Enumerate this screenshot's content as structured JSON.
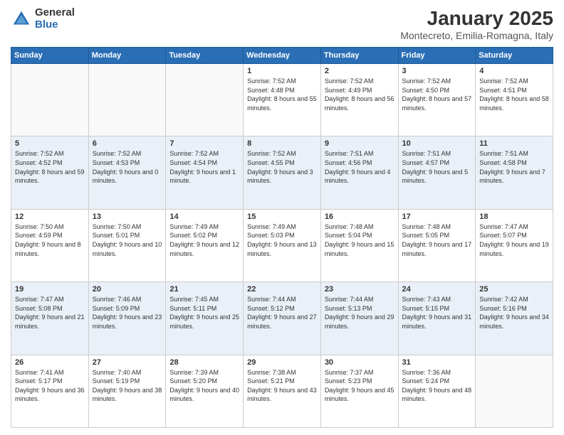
{
  "logo": {
    "general": "General",
    "blue": "Blue"
  },
  "header": {
    "title": "January 2025",
    "subtitle": "Montecreto, Emilia-Romagna, Italy"
  },
  "weekdays": [
    "Sunday",
    "Monday",
    "Tuesday",
    "Wednesday",
    "Thursday",
    "Friday",
    "Saturday"
  ],
  "weeks": [
    [
      {
        "day": "",
        "sunrise": "",
        "sunset": "",
        "daylight": ""
      },
      {
        "day": "",
        "sunrise": "",
        "sunset": "",
        "daylight": ""
      },
      {
        "day": "",
        "sunrise": "",
        "sunset": "",
        "daylight": ""
      },
      {
        "day": "1",
        "sunrise": "Sunrise: 7:52 AM",
        "sunset": "Sunset: 4:48 PM",
        "daylight": "Daylight: 8 hours and 55 minutes."
      },
      {
        "day": "2",
        "sunrise": "Sunrise: 7:52 AM",
        "sunset": "Sunset: 4:49 PM",
        "daylight": "Daylight: 8 hours and 56 minutes."
      },
      {
        "day": "3",
        "sunrise": "Sunrise: 7:52 AM",
        "sunset": "Sunset: 4:50 PM",
        "daylight": "Daylight: 8 hours and 57 minutes."
      },
      {
        "day": "4",
        "sunrise": "Sunrise: 7:52 AM",
        "sunset": "Sunset: 4:51 PM",
        "daylight": "Daylight: 8 hours and 58 minutes."
      }
    ],
    [
      {
        "day": "5",
        "sunrise": "Sunrise: 7:52 AM",
        "sunset": "Sunset: 4:52 PM",
        "daylight": "Daylight: 8 hours and 59 minutes."
      },
      {
        "day": "6",
        "sunrise": "Sunrise: 7:52 AM",
        "sunset": "Sunset: 4:53 PM",
        "daylight": "Daylight: 9 hours and 0 minutes."
      },
      {
        "day": "7",
        "sunrise": "Sunrise: 7:52 AM",
        "sunset": "Sunset: 4:54 PM",
        "daylight": "Daylight: 9 hours and 1 minute."
      },
      {
        "day": "8",
        "sunrise": "Sunrise: 7:52 AM",
        "sunset": "Sunset: 4:55 PM",
        "daylight": "Daylight: 9 hours and 3 minutes."
      },
      {
        "day": "9",
        "sunrise": "Sunrise: 7:51 AM",
        "sunset": "Sunset: 4:56 PM",
        "daylight": "Daylight: 9 hours and 4 minutes."
      },
      {
        "day": "10",
        "sunrise": "Sunrise: 7:51 AM",
        "sunset": "Sunset: 4:57 PM",
        "daylight": "Daylight: 9 hours and 5 minutes."
      },
      {
        "day": "11",
        "sunrise": "Sunrise: 7:51 AM",
        "sunset": "Sunset: 4:58 PM",
        "daylight": "Daylight: 9 hours and 7 minutes."
      }
    ],
    [
      {
        "day": "12",
        "sunrise": "Sunrise: 7:50 AM",
        "sunset": "Sunset: 4:59 PM",
        "daylight": "Daylight: 9 hours and 8 minutes."
      },
      {
        "day": "13",
        "sunrise": "Sunrise: 7:50 AM",
        "sunset": "Sunset: 5:01 PM",
        "daylight": "Daylight: 9 hours and 10 minutes."
      },
      {
        "day": "14",
        "sunrise": "Sunrise: 7:49 AM",
        "sunset": "Sunset: 5:02 PM",
        "daylight": "Daylight: 9 hours and 12 minutes."
      },
      {
        "day": "15",
        "sunrise": "Sunrise: 7:49 AM",
        "sunset": "Sunset: 5:03 PM",
        "daylight": "Daylight: 9 hours and 13 minutes."
      },
      {
        "day": "16",
        "sunrise": "Sunrise: 7:48 AM",
        "sunset": "Sunset: 5:04 PM",
        "daylight": "Daylight: 9 hours and 15 minutes."
      },
      {
        "day": "17",
        "sunrise": "Sunrise: 7:48 AM",
        "sunset": "Sunset: 5:05 PM",
        "daylight": "Daylight: 9 hours and 17 minutes."
      },
      {
        "day": "18",
        "sunrise": "Sunrise: 7:47 AM",
        "sunset": "Sunset: 5:07 PM",
        "daylight": "Daylight: 9 hours and 19 minutes."
      }
    ],
    [
      {
        "day": "19",
        "sunrise": "Sunrise: 7:47 AM",
        "sunset": "Sunset: 5:08 PM",
        "daylight": "Daylight: 9 hours and 21 minutes."
      },
      {
        "day": "20",
        "sunrise": "Sunrise: 7:46 AM",
        "sunset": "Sunset: 5:09 PM",
        "daylight": "Daylight: 9 hours and 23 minutes."
      },
      {
        "day": "21",
        "sunrise": "Sunrise: 7:45 AM",
        "sunset": "Sunset: 5:11 PM",
        "daylight": "Daylight: 9 hours and 25 minutes."
      },
      {
        "day": "22",
        "sunrise": "Sunrise: 7:44 AM",
        "sunset": "Sunset: 5:12 PM",
        "daylight": "Daylight: 9 hours and 27 minutes."
      },
      {
        "day": "23",
        "sunrise": "Sunrise: 7:44 AM",
        "sunset": "Sunset: 5:13 PM",
        "daylight": "Daylight: 9 hours and 29 minutes."
      },
      {
        "day": "24",
        "sunrise": "Sunrise: 7:43 AM",
        "sunset": "Sunset: 5:15 PM",
        "daylight": "Daylight: 9 hours and 31 minutes."
      },
      {
        "day": "25",
        "sunrise": "Sunrise: 7:42 AM",
        "sunset": "Sunset: 5:16 PM",
        "daylight": "Daylight: 9 hours and 34 minutes."
      }
    ],
    [
      {
        "day": "26",
        "sunrise": "Sunrise: 7:41 AM",
        "sunset": "Sunset: 5:17 PM",
        "daylight": "Daylight: 9 hours and 36 minutes."
      },
      {
        "day": "27",
        "sunrise": "Sunrise: 7:40 AM",
        "sunset": "Sunset: 5:19 PM",
        "daylight": "Daylight: 9 hours and 38 minutes."
      },
      {
        "day": "28",
        "sunrise": "Sunrise: 7:39 AM",
        "sunset": "Sunset: 5:20 PM",
        "daylight": "Daylight: 9 hours and 40 minutes."
      },
      {
        "day": "29",
        "sunrise": "Sunrise: 7:38 AM",
        "sunset": "Sunset: 5:21 PM",
        "daylight": "Daylight: 9 hours and 43 minutes."
      },
      {
        "day": "30",
        "sunrise": "Sunrise: 7:37 AM",
        "sunset": "Sunset: 5:23 PM",
        "daylight": "Daylight: 9 hours and 45 minutes."
      },
      {
        "day": "31",
        "sunrise": "Sunrise: 7:36 AM",
        "sunset": "Sunset: 5:24 PM",
        "daylight": "Daylight: 9 hours and 48 minutes."
      },
      {
        "day": "",
        "sunrise": "",
        "sunset": "",
        "daylight": ""
      }
    ]
  ]
}
